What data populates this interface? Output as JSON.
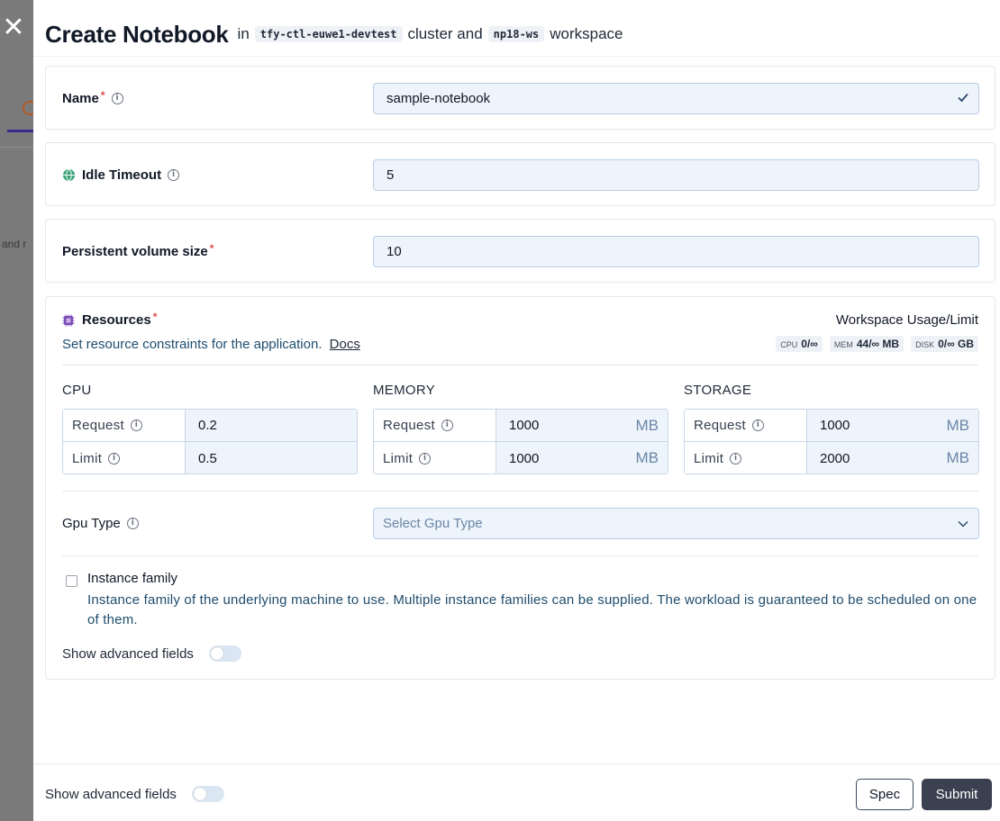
{
  "background": {
    "partial_text": "and r"
  },
  "header": {
    "title": "Create Notebook",
    "in_text": "in",
    "cluster": "tfy-ctl-euwe1-devtest",
    "cluster_text": "cluster and",
    "workspace": "np18-ws",
    "workspace_text": "workspace"
  },
  "name_field": {
    "label": "Name",
    "required": "*",
    "value": "sample-notebook"
  },
  "idle_timeout": {
    "label": "Idle Timeout",
    "value": "5"
  },
  "persistent_volume": {
    "label": "Persistent volume size",
    "required": "*",
    "value": "10"
  },
  "resources": {
    "label": "Resources",
    "required": "*",
    "description": "Set resource constraints for the application.",
    "docs_link": "Docs",
    "usage_title": "Workspace Usage/Limit",
    "usage": [
      {
        "key": "CPU",
        "value": "0/∞"
      },
      {
        "key": "MEM",
        "value": "44/∞ MB"
      },
      {
        "key": "DISK",
        "value": "0/∞ GB"
      }
    ],
    "groups": {
      "cpu": {
        "title": "CPU",
        "request_label": "Request",
        "request": "0.2",
        "limit_label": "Limit",
        "limit": "0.5",
        "unit": ""
      },
      "memory": {
        "title": "MEMORY",
        "request_label": "Request",
        "request": "1000",
        "limit_label": "Limit",
        "limit": "1000",
        "unit": "MB"
      },
      "storage": {
        "title": "STORAGE",
        "request_label": "Request",
        "request": "1000",
        "limit_label": "Limit",
        "limit": "2000",
        "unit": "MB"
      }
    },
    "gpu_type": {
      "label": "Gpu Type",
      "placeholder": "Select Gpu Type"
    },
    "instance_family": {
      "label": "Instance family",
      "description": "Instance family of the underlying machine to use. Multiple instance families can be supplied. The workload is guaranteed to be scheduled on one of them."
    },
    "show_advanced": "Show advanced fields"
  },
  "footer": {
    "show_advanced": "Show advanced fields",
    "spec_label": "Spec",
    "submit_label": "Submit"
  },
  "colors": {
    "accent": "#3b2a8f",
    "input_bg": "#eef4fb",
    "submit_bg": "#3b4150",
    "required": "#e04a4a"
  }
}
